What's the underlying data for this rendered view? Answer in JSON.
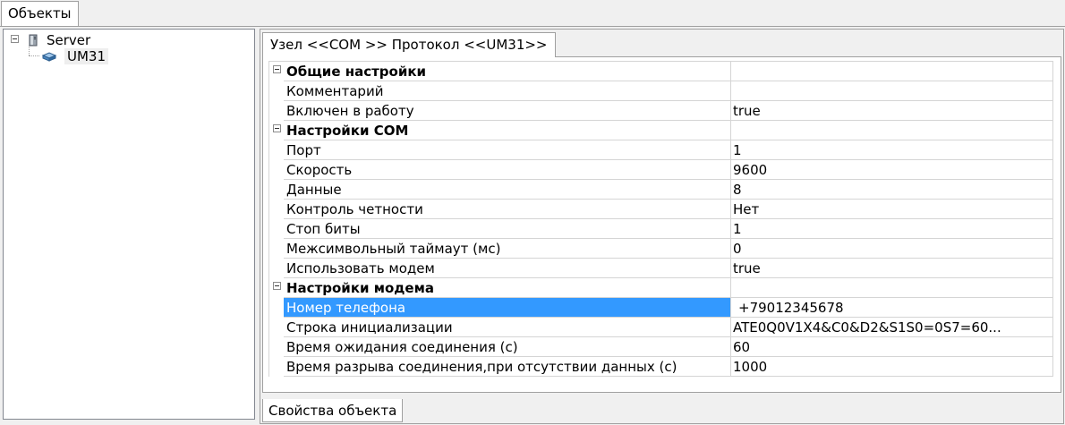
{
  "top_tab": {
    "label": "Объекты"
  },
  "tree": {
    "nodes": [
      {
        "label": "Server",
        "icon": "server-icon"
      },
      {
        "label": "UM31",
        "icon": "device-icon"
      }
    ]
  },
  "editor_tab": {
    "label": "Узел <<COM  >> Протокол <<UM31>>"
  },
  "properties": {
    "rows": [
      {
        "type": "group",
        "label": "Общие настройки",
        "value": ""
      },
      {
        "type": "item",
        "label": "Комментарий",
        "value": ""
      },
      {
        "type": "item",
        "label": "Включен в работу",
        "value": "true"
      },
      {
        "type": "group",
        "label": "Настройки COM",
        "value": ""
      },
      {
        "type": "item",
        "label": "Порт",
        "value": "1"
      },
      {
        "type": "item",
        "label": "Скорость",
        "value": "9600"
      },
      {
        "type": "item",
        "label": "Данные",
        "value": "8"
      },
      {
        "type": "item",
        "label": "Контроль четности",
        "value": "Нет"
      },
      {
        "type": "item",
        "label": "Стоп биты",
        "value": "1"
      },
      {
        "type": "item",
        "label": "Межсимвольный таймаут (мс)",
        "value": "0"
      },
      {
        "type": "item",
        "label": "Использовать модем",
        "value": "true"
      },
      {
        "type": "group",
        "label": "Настройки модема",
        "value": ""
      },
      {
        "type": "item",
        "label": "Номер телефона",
        "value": "+79012345678",
        "selected": true
      },
      {
        "type": "item",
        "label": "Строка инициализации",
        "value": "ATE0Q0V1X4&C0&D2&S1S0=0S7=60..."
      },
      {
        "type": "item",
        "label": "Время ожидания соединения (с)",
        "value": "60"
      },
      {
        "type": "item",
        "label": "Время разрыва соединения,при отсутствии данных (с)",
        "value": "1000"
      }
    ]
  },
  "bottom_tab": {
    "label": "Свойства объекта"
  },
  "colors": {
    "selection": "#3399ff",
    "grid_line": "#d5d5d5",
    "border": "#a0a0a0"
  }
}
